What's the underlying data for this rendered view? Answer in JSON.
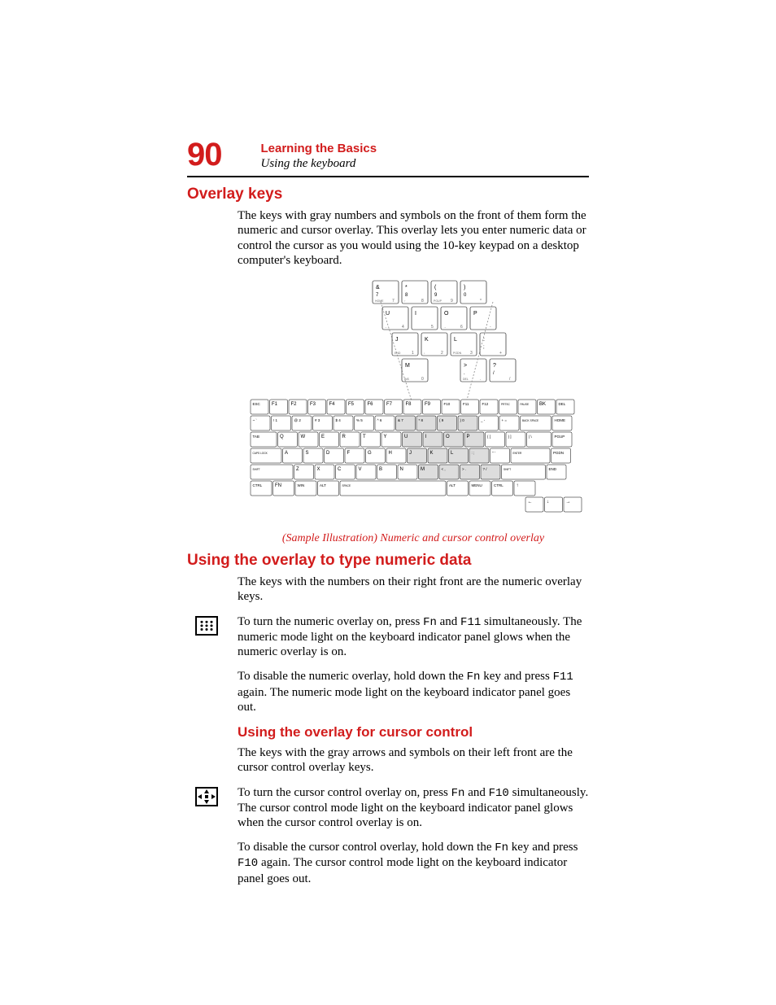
{
  "header": {
    "pageNumber": "90",
    "chapter": "Learning the Basics",
    "section": "Using the keyboard"
  },
  "h2_overlay": "Overlay keys",
  "p_overlay_intro": "The keys with gray numbers and symbols on the front of them form the numeric and cursor overlay. This overlay lets you enter numeric data or control the cursor as you would using the 10-key keypad on a desktop computer's keyboard.",
  "caption_overlay": "(Sample Illustration) Numeric and cursor control overlay",
  "h2_numeric": "Using the overlay to type numeric data",
  "p_numeric_1": "The keys with the numbers on their right front are the numeric overlay keys.",
  "p_numeric_2a": "To turn the numeric overlay on, press ",
  "p_numeric_2b": " and ",
  "p_numeric_2c": " simultaneously. The numeric mode light on the keyboard indicator panel glows when the numeric overlay is on.",
  "key_fn": "Fn",
  "key_f11": "F11",
  "p_numeric_3a": "To disable the numeric overlay, hold down the ",
  "p_numeric_3b": " key and press ",
  "p_numeric_3c": " again. The numeric mode light on the keyboard indicator panel goes out.",
  "h3_cursor": "Using the overlay for cursor control",
  "p_cursor_1": "The keys with the gray arrows and symbols on their left front are the cursor control overlay keys.",
  "p_cursor_2a": "To turn the cursor control overlay on, press ",
  "p_cursor_2b": " and ",
  "p_cursor_2c": " simultaneously. The cursor control mode light on the keyboard indicator panel glows when the cursor control overlay is on.",
  "key_f10": "F10",
  "p_cursor_3a": "To disable the cursor control overlay, hold down the ",
  "p_cursor_3b": " key and press ",
  "p_cursor_3c": " again. The cursor control mode light on the keyboard indicator panel goes out.",
  "keyboard": {
    "zoomRows": [
      [
        {
          "main": "&",
          "sub1": "7",
          "sub2": "HOME",
          "sub3": "7"
        },
        {
          "main": "*",
          "sub1": "8",
          "sub2": "↑",
          "sub3": "8"
        },
        {
          "main": "(",
          "sub1": "9",
          "sub2": "PGUP",
          "sub3": "9"
        },
        {
          "main": ")",
          "sub1": "0",
          "sub2": "",
          "sub3": "*"
        }
      ],
      [
        {
          "main": "U",
          "sub2": "←",
          "sub3": "4"
        },
        {
          "main": "I",
          "sub2": "",
          "sub3": "5"
        },
        {
          "main": "O",
          "sub2": "→",
          "sub3": "6"
        },
        {
          "main": "P",
          "sub2": "",
          "sub3": "-"
        }
      ],
      [
        {
          "main": "J",
          "sub2": "END",
          "sub3": "1"
        },
        {
          "main": "K",
          "sub2": "↓",
          "sub3": "2"
        },
        {
          "main": "L",
          "sub2": "PGDN",
          "sub3": "3"
        },
        {
          "main": ":",
          "sub1": ";",
          "sub2": "",
          "sub3": "+"
        }
      ],
      [
        {
          "main": "M",
          "sub2": "INS",
          "sub3": "0"
        },
        null,
        {
          "main": ">",
          "sub1": ".",
          "sub2": "DEL",
          "sub3": "."
        },
        {
          "main": "?",
          "sub1": "/",
          "sub2": "",
          "sub3": "/"
        }
      ]
    ],
    "fullRows": [
      [
        "ESC",
        "F1",
        "F2",
        "F3",
        "F4",
        "F5",
        "F6",
        "F7",
        "F8",
        "F9",
        "F10",
        "F11",
        "F12",
        "PRTSC",
        "PAUSE",
        "BK",
        "DEL"
      ],
      [
        "~ `",
        "! 1",
        "@ 2",
        "# 3",
        "$ 4",
        "% 5",
        "^ 6",
        "& 7",
        "* 8",
        "( 9",
        ") 0",
        "_ -",
        "+ =",
        "BACK SPACE",
        "HOME"
      ],
      [
        "TAB",
        "Q",
        "W",
        "E",
        "R",
        "T",
        "Y",
        "U",
        "I",
        "O",
        "P",
        "{ [",
        "} ]",
        "| \\",
        "PGUP"
      ],
      [
        "CAPS LOCK",
        "A",
        "S",
        "D",
        "F",
        "G",
        "H",
        "J",
        "K",
        "L",
        ": ;",
        "\" '",
        "ENTER",
        "PGDN"
      ],
      [
        "SHIFT",
        "Z",
        "X",
        "C",
        "V",
        "B",
        "N",
        "M",
        "< ,",
        "> .",
        "? /",
        "SHIFT",
        "END"
      ],
      [
        "CTRL",
        "FN",
        "WIN",
        "ALT",
        "SPACE",
        "ALT",
        "MENU",
        "CTRL",
        "↑"
      ],
      [
        "←",
        "↓",
        "→"
      ]
    ]
  }
}
